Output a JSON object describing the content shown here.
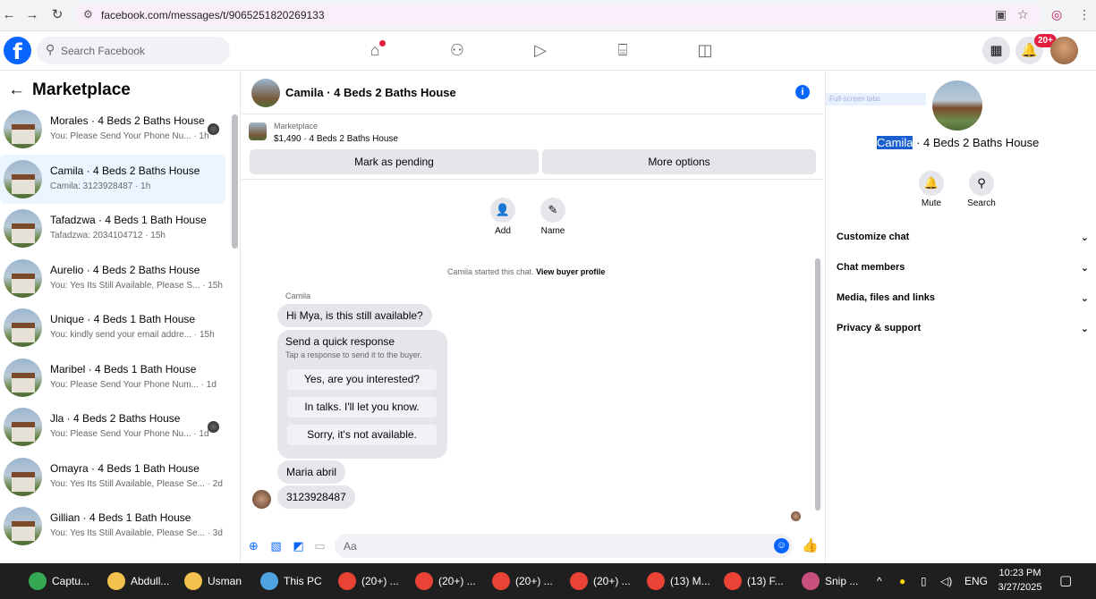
{
  "browser": {
    "url": "facebook.com/messages/t/9065251820269133"
  },
  "fb": {
    "search_placeholder": "Search Facebook",
    "notif_badge": "20+"
  },
  "left": {
    "title": "Marketplace",
    "conversations": [
      {
        "name": "Morales · 4 Beds 2 Baths House",
        "sub": "You: Please Send Your Phone Nu... · 1h",
        "mini": true
      },
      {
        "name": "Camila · 4 Beds 2 Baths House",
        "sub": "Camila: 3123928487 · 1h",
        "active": true
      },
      {
        "name": "Tafadzwa · 4 Beds 1 Bath House",
        "sub": "Tafadzwa: 2034104712 · 15h"
      },
      {
        "name": "Aurelio · 4 Beds 2 Baths House",
        "sub": "You: Yes Its Still Available, Please S... · 15h"
      },
      {
        "name": "Unique · 4 Beds 1 Bath House",
        "sub": "You: kindly send your email addre... · 15h"
      },
      {
        "name": "Maribel · 4 Beds 1 Bath House",
        "sub": "You: Please Send Your Phone Num... · 1d"
      },
      {
        "name": "Jla · 4 Beds 2 Baths House",
        "sub": "You: Please Send Your Phone Nu... · 1d",
        "mini": true
      },
      {
        "name": "Omayra · 4 Beds 1 Bath House",
        "sub": "You: Yes Its Still Available, Please Se... · 2d"
      },
      {
        "name": "Gillian · 4 Beds 1 Bath House",
        "sub": "You: Yes Its Still Available, Please Se... · 3d"
      }
    ]
  },
  "chat": {
    "title": "Camila · 4 Beds 2 Baths House",
    "listing_category": "Marketplace",
    "listing_price": "$1,490 · 4 Beds 2 Baths House",
    "mark_pending": "Mark as pending",
    "more_options": "More options",
    "add_label": "Add",
    "name_label": "Name",
    "system_msg": "Camila started this chat.",
    "system_link": "View buyer profile",
    "sender": "Camila",
    "msg1": "Hi Mya, is this still available?",
    "quick_title": "Send a quick response",
    "quick_sub": "Tap a response to send it to the buyer.",
    "quick_options": [
      "Yes, are you interested?",
      "In talks. I'll let you know.",
      "Sorry, it's not available."
    ],
    "msg2": "Maria abril",
    "msg3": "3123928487",
    "composer_placeholder": "Aa"
  },
  "right": {
    "title_selected": "Camila",
    "title_rest": " · 4 Beds 2 Baths House",
    "ghost": "Full-screen tabs",
    "mute": "Mute",
    "search": "Search",
    "sections": [
      "Customize chat",
      "Chat members",
      "Media, files and links",
      "Privacy & support"
    ]
  },
  "taskbar": {
    "items": [
      {
        "label": "Captu...",
        "color": "#34a853"
      },
      {
        "label": "Abdull...",
        "color": "#f2c14e"
      },
      {
        "label": "Usman",
        "color": "#f2c14e"
      },
      {
        "label": "This PC",
        "color": "#4fa3e0"
      },
      {
        "label": "(20+) ...",
        "color": "#ea4335"
      },
      {
        "label": "(20+) ...",
        "color": "#ea4335"
      },
      {
        "label": "(20+) ...",
        "color": "#ea4335"
      },
      {
        "label": "(20+) ...",
        "color": "#ea4335"
      },
      {
        "label": "(13) M...",
        "color": "#ea4335"
      },
      {
        "label": "(13) F...",
        "color": "#ea4335"
      },
      {
        "label": "Snip ...",
        "color": "#c94f7c"
      }
    ],
    "lang": "ENG",
    "time": "10:23 PM",
    "date": "3/27/2025"
  }
}
